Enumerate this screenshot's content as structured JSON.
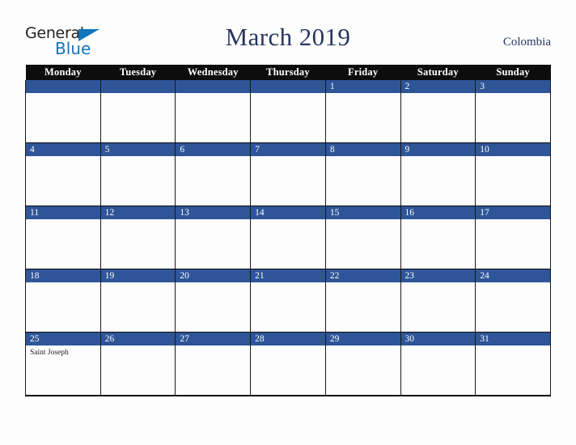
{
  "brand": {
    "name_part1": "General",
    "name_part2": "Blue",
    "triangle_icon": "triangle-icon",
    "accent_color": "#1275bc",
    "text_color": "#231f20"
  },
  "header": {
    "title": "March 2019",
    "country": "Colombia",
    "title_color": "#27365e"
  },
  "calendar": {
    "weekday_headers": [
      "Monday",
      "Tuesday",
      "Wednesday",
      "Thursday",
      "Friday",
      "Saturday",
      "Sunday"
    ],
    "header_bg": "#0d0d0d",
    "daybar_bg": "#2e5597",
    "weeks": [
      [
        {
          "date": "",
          "holiday": ""
        },
        {
          "date": "",
          "holiday": ""
        },
        {
          "date": "",
          "holiday": ""
        },
        {
          "date": "",
          "holiday": ""
        },
        {
          "date": "1",
          "holiday": ""
        },
        {
          "date": "2",
          "holiday": ""
        },
        {
          "date": "3",
          "holiday": ""
        }
      ],
      [
        {
          "date": "4",
          "holiday": ""
        },
        {
          "date": "5",
          "holiday": ""
        },
        {
          "date": "6",
          "holiday": ""
        },
        {
          "date": "7",
          "holiday": ""
        },
        {
          "date": "8",
          "holiday": ""
        },
        {
          "date": "9",
          "holiday": ""
        },
        {
          "date": "10",
          "holiday": ""
        }
      ],
      [
        {
          "date": "11",
          "holiday": ""
        },
        {
          "date": "12",
          "holiday": ""
        },
        {
          "date": "13",
          "holiday": ""
        },
        {
          "date": "14",
          "holiday": ""
        },
        {
          "date": "15",
          "holiday": ""
        },
        {
          "date": "16",
          "holiday": ""
        },
        {
          "date": "17",
          "holiday": ""
        }
      ],
      [
        {
          "date": "18",
          "holiday": ""
        },
        {
          "date": "19",
          "holiday": ""
        },
        {
          "date": "20",
          "holiday": ""
        },
        {
          "date": "21",
          "holiday": ""
        },
        {
          "date": "22",
          "holiday": ""
        },
        {
          "date": "23",
          "holiday": ""
        },
        {
          "date": "24",
          "holiday": ""
        }
      ],
      [
        {
          "date": "25",
          "holiday": "Saint Joseph"
        },
        {
          "date": "26",
          "holiday": ""
        },
        {
          "date": "27",
          "holiday": ""
        },
        {
          "date": "28",
          "holiday": ""
        },
        {
          "date": "29",
          "holiday": ""
        },
        {
          "date": "30",
          "holiday": ""
        },
        {
          "date": "31",
          "holiday": ""
        }
      ]
    ]
  }
}
